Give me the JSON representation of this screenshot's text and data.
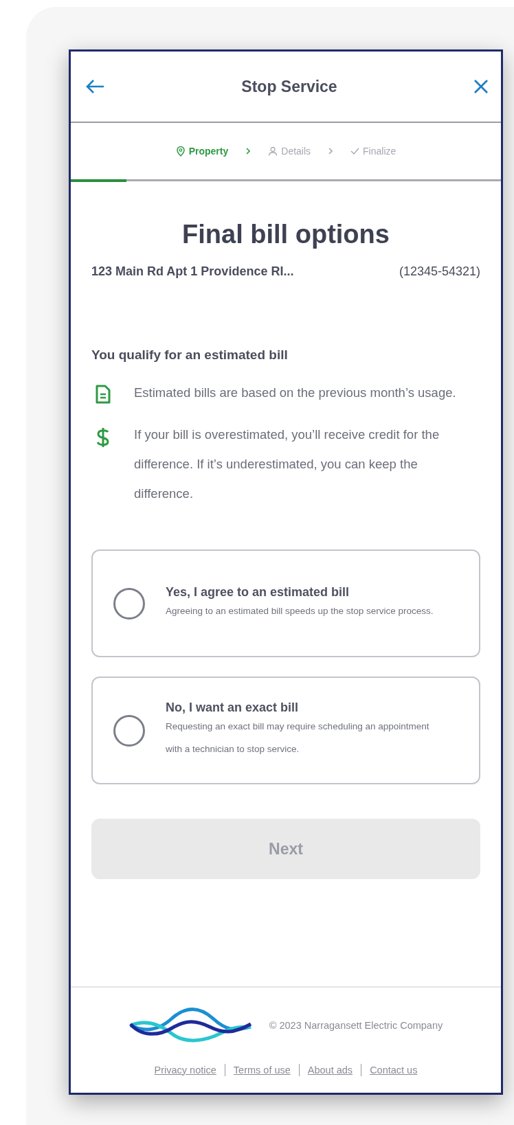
{
  "header": {
    "title": "Stop Service"
  },
  "steps": [
    {
      "label": "Property",
      "selected": true
    },
    {
      "label": "Details",
      "selected": false
    },
    {
      "label": "Finalize",
      "selected": false
    }
  ],
  "progress": {
    "level": 0.13
  },
  "heading": "Final bill options",
  "account": {
    "address": "123 Main Rd Apt 1 Providence RI...",
    "number": "(12345-54321)"
  },
  "qualify": {
    "title": "You qualify for an estimated bill",
    "points": [
      {
        "text": "Estimated bills are based on the previous month’s usage."
      },
      {
        "text": "If your bill is overestimated, you’ll receive credit for the difference. If it’s underestimated, you can keep the difference."
      }
    ]
  },
  "options": [
    {
      "title": "Yes, I agree to an estimated bill",
      "description": "Agreeing to an estimated bill speeds up the stop service process.",
      "selected": false
    },
    {
      "title": "No, I want an exact bill",
      "description": "Requesting an exact bill may require scheduling an appointment with a technician to stop service.",
      "selected": false
    }
  ],
  "next_button": {
    "label": "Next",
    "disabled": true
  },
  "footer": {
    "copyright": "© 2023 Narragansett Electric Company",
    "links": [
      "Privacy notice",
      "Terms of use",
      "About ads",
      "Contact us"
    ]
  }
}
